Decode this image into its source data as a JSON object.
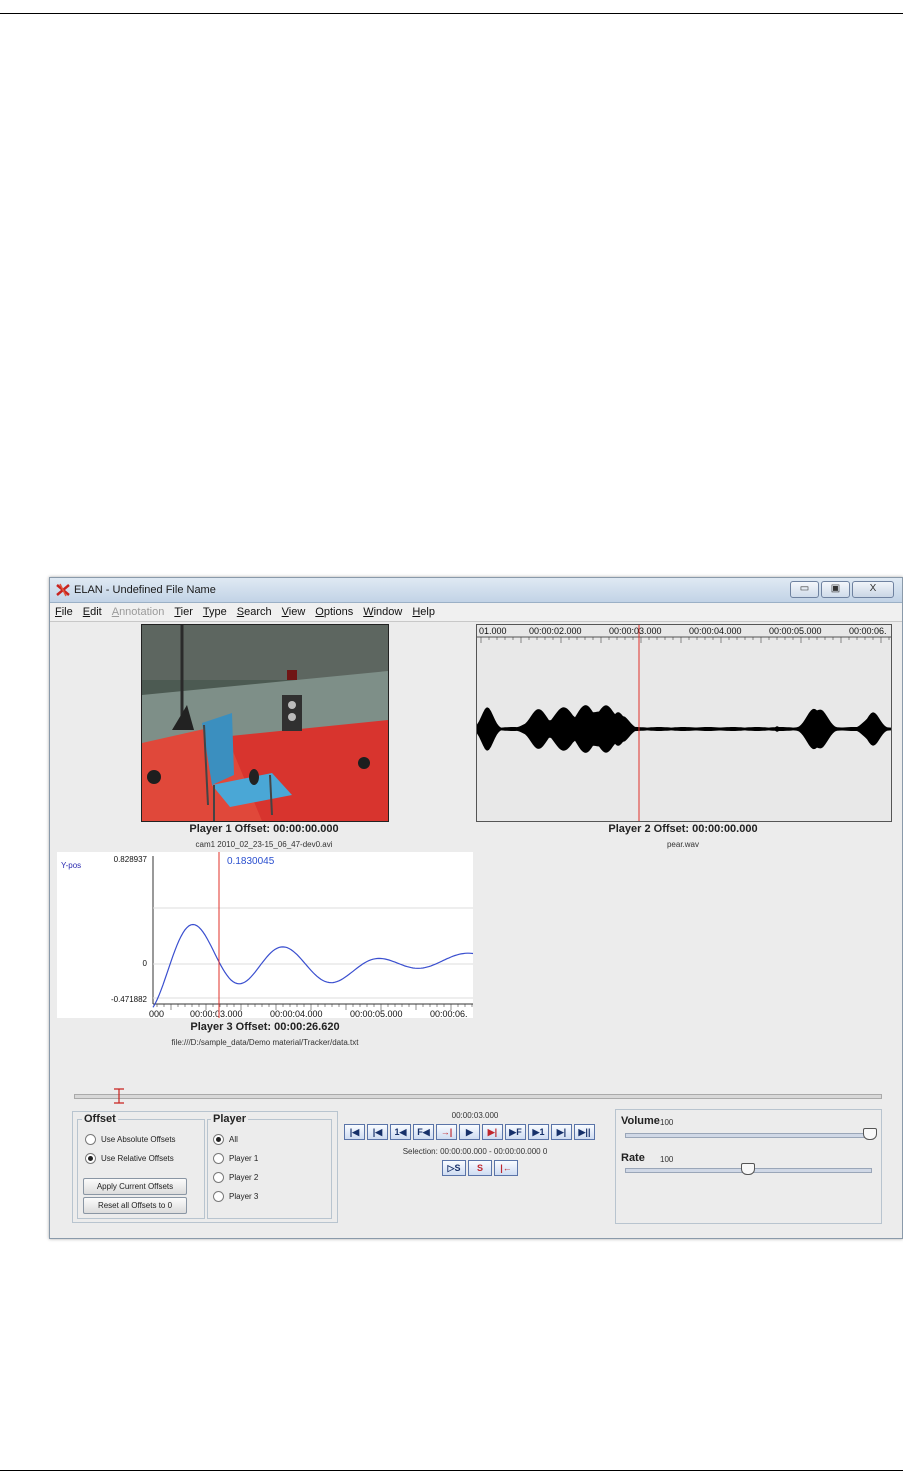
{
  "window": {
    "title": "ELAN - Undefined File Name",
    "controls": {
      "minimize": "▭",
      "maximize": "▣",
      "close": "X"
    }
  },
  "menu": [
    "File",
    "Edit",
    "Annotation",
    "Tier",
    "Type",
    "Search",
    "View",
    "Options",
    "Window",
    "Help"
  ],
  "menu_disabled": [
    "Annotation"
  ],
  "player1": {
    "offset_label": "Player 1 Offset: 00:00:00.000",
    "file": "cam1 2010_02_23-15_06_47-dev0.avi"
  },
  "player2": {
    "offset_label": "Player 2 Offset: 00:00:00.000",
    "file": "pear.wav",
    "ruler": [
      "01.000",
      "00:00:02.000",
      "00:00:03.000",
      "00:00:04.000",
      "00:00:05.000",
      "00:00:06."
    ]
  },
  "player3": {
    "offset_label": "Player 3 Offset: 00:00:26.620",
    "file": "file:///D:/sample_data/Demo material/Tracker/data.txt",
    "series_label": "Y-pos",
    "y_max": "0.828937",
    "y_zero": "0",
    "y_min": "-0.471882",
    "cursor_value": "0.1830045",
    "ruler": [
      "000",
      "00:00:03.000",
      "00:00:04.000",
      "00:00:05.000",
      "00:00:06."
    ]
  },
  "offset_panel": {
    "title": "Offset",
    "options": [
      "Use Absolute Offsets",
      "Use Relative Offsets"
    ],
    "selected": 1,
    "apply_button": "Apply Current Offsets",
    "reset_button": "Reset all Offsets to 0"
  },
  "player_panel": {
    "title": "Player",
    "options": [
      "All",
      "Player 1",
      "Player 2",
      "Player 3"
    ],
    "selected": 0
  },
  "transport": {
    "time": "00:00:03.000",
    "buttons": [
      "|◀",
      "|◀",
      "1◀",
      "F◀",
      "→|",
      "▶",
      "▶|",
      "▶F",
      "▶1",
      "▶|",
      "▶||"
    ],
    "selection": "Selection: 00:00:00.000 - 00:00:00.000  0",
    "sel_buttons": [
      "▷S",
      "S",
      "|←"
    ]
  },
  "volume": {
    "label": "Volume",
    "value": "100",
    "level": 1.0
  },
  "rate": {
    "label": "Rate",
    "value": "100",
    "level": 0.5
  },
  "colors": {
    "cursor": "#e0302a",
    "series": "#3a4fcf",
    "wave": "#000000"
  }
}
